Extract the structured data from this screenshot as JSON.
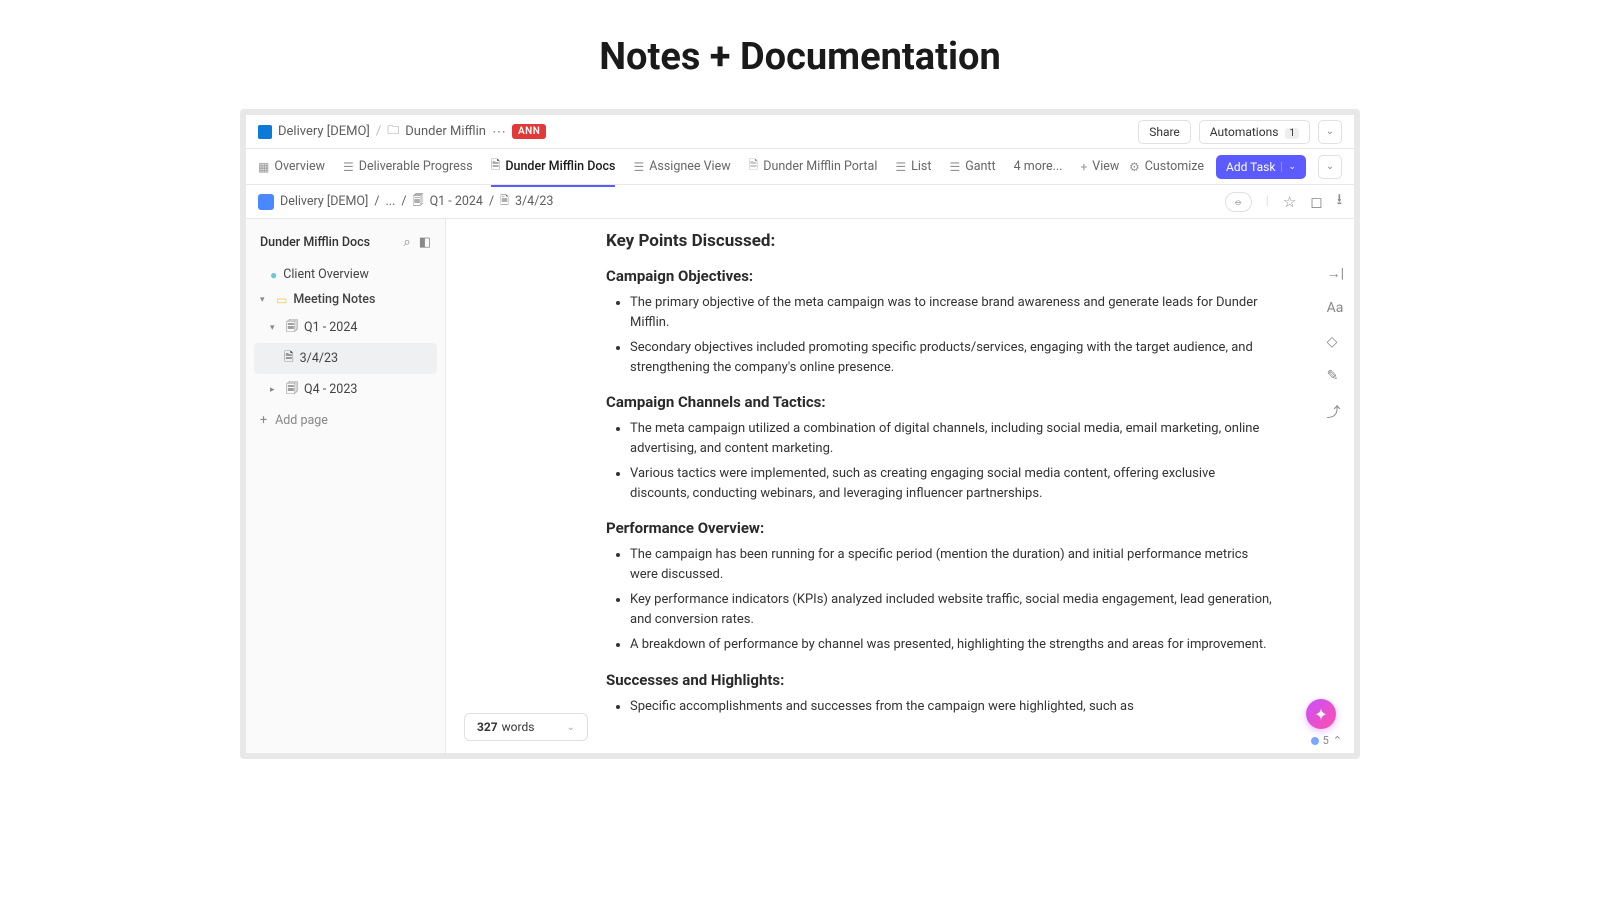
{
  "page_heading": "Notes + Documentation",
  "breadcrumb": {
    "root": "Delivery [DEMO]",
    "folder": "Dunder Mifflin",
    "badge": "ANN"
  },
  "top_actions": {
    "share": "Share",
    "automations": "Automations",
    "automations_count": "1"
  },
  "tabs": {
    "overview": "Overview",
    "deliverable": "Deliverable Progress",
    "docs": "Dunder Mifflin Docs",
    "assignee": "Assignee View",
    "portal": "Dunder Mifflin Portal",
    "list": "List",
    "gantt": "Gantt",
    "more": "4 more...",
    "view": "View",
    "customize": "Customize",
    "add_task": "Add Task"
  },
  "doc_crumb": {
    "a": "Delivery [DEMO]",
    "b": "...",
    "c": "Q1 - 2024",
    "d": "3/4/23"
  },
  "sidebar": {
    "title": "Dunder Mifflin Docs",
    "client": "Client Overview",
    "meeting": "Meeting Notes",
    "q1": "Q1 - 2024",
    "page": "3/4/23",
    "q4": "Q4 - 2023",
    "add": "Add page"
  },
  "document": {
    "h_keypoints": "Key Points Discussed:",
    "h_objectives": "Campaign Objectives:",
    "obj1": "The primary objective of the meta campaign was to increase brand awareness and generate leads for Dunder Mifflin.",
    "obj2": "Secondary objectives included promoting specific products/services, engaging with the target audience, and strengthening the company's online presence.",
    "h_channels": "Campaign Channels and Tactics:",
    "ch1": "The meta campaign utilized a combination of digital channels, including social media, email marketing, online advertising, and content marketing.",
    "ch2": "Various tactics were implemented, such as creating engaging social media content, offering exclusive discounts, conducting webinars, and leveraging influencer partnerships.",
    "h_perf": "Performance Overview:",
    "p1": "The campaign has been running for a specific period (mention the duration) and initial performance metrics were discussed.",
    "p2": "Key performance indicators (KPIs) analyzed included website traffic, social media engagement, lead generation, and conversion rates.",
    "p3": "A breakdown of performance by channel was presented, highlighting the strengths and areas for improvement.",
    "h_success": "Successes and Highlights:",
    "s1": "Specific accomplishments and successes from the campaign were highlighted, such as"
  },
  "word_count": {
    "num": "327",
    "label": "words"
  },
  "presence_count": "5"
}
